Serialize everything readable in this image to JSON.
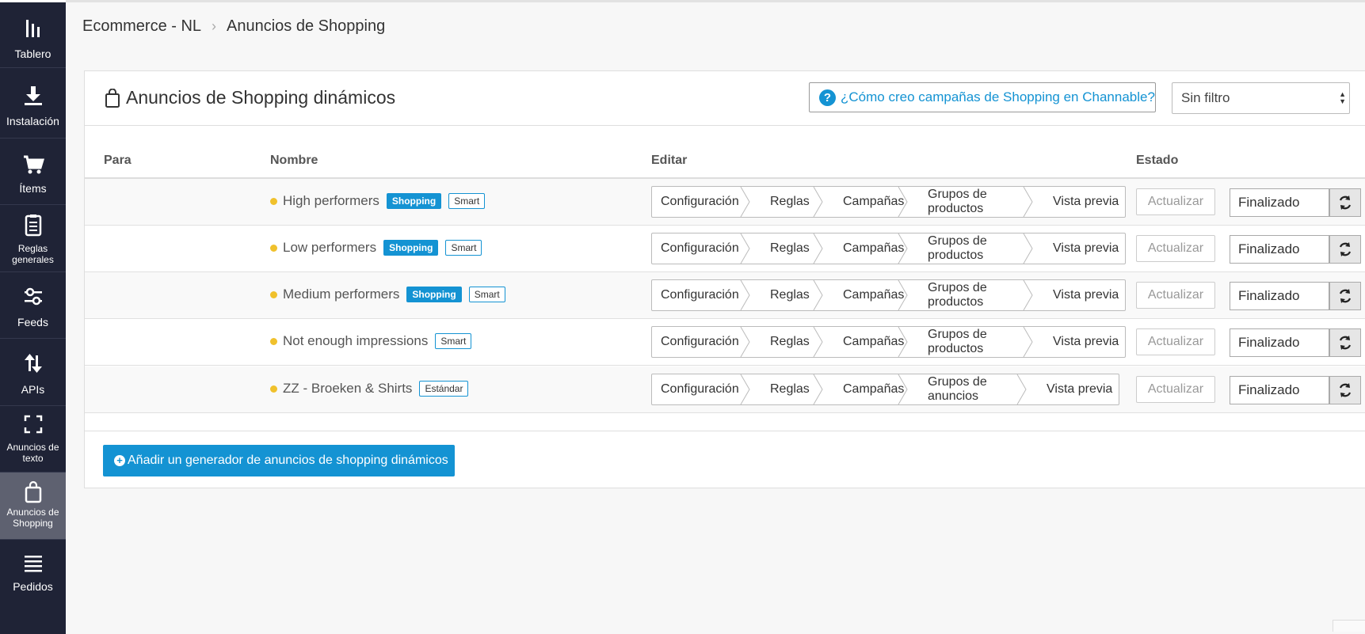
{
  "sidebar": {
    "items": [
      {
        "label": "Tablero",
        "icon": "bar-chart-icon"
      },
      {
        "label": "Instalación",
        "icon": "download-icon"
      },
      {
        "label": "Ítems",
        "icon": "cart-icon"
      },
      {
        "label": "Reglas generales",
        "icon": "clipboard-icon"
      },
      {
        "label": "Feeds",
        "icon": "sliders-icon"
      },
      {
        "label": "APIs",
        "icon": "arrows-updown-icon"
      },
      {
        "label": "Anuncios de texto",
        "icon": "frame-corners-icon"
      },
      {
        "label": "Anuncios de Shopping",
        "icon": "shopping-bag-icon",
        "active": true
      },
      {
        "label": "Pedidos",
        "icon": "list-icon"
      }
    ]
  },
  "breadcrumb": {
    "project": "Ecommerce - NL",
    "current": "Anuncios de Shopping"
  },
  "panel": {
    "title": "Anuncios de Shopping dinámicos",
    "help_link": "¿Cómo creo campañas de Shopping en Channable?",
    "filter": {
      "selected": "Sin filtro"
    },
    "columns": {
      "para": "Para",
      "nombre": "Nombre",
      "editar": "Editar",
      "estado": "Estado"
    },
    "rows": [
      {
        "name": "High performers",
        "tags": [
          "Shopping",
          "Smart"
        ],
        "steps": [
          "Configuración",
          "Reglas",
          "Campañas",
          "Grupos de productos",
          "Vista previa"
        ],
        "update": "Actualizar",
        "status": "Finalizado"
      },
      {
        "name": "Low performers",
        "tags": [
          "Shopping",
          "Smart"
        ],
        "steps": [
          "Configuración",
          "Reglas",
          "Campañas",
          "Grupos de productos",
          "Vista previa"
        ],
        "update": "Actualizar",
        "status": "Finalizado"
      },
      {
        "name": "Medium performers",
        "tags": [
          "Shopping",
          "Smart"
        ],
        "steps": [
          "Configuración",
          "Reglas",
          "Campañas",
          "Grupos de productos",
          "Vista previa"
        ],
        "update": "Actualizar",
        "status": "Finalizado"
      },
      {
        "name": "Not enough impressions",
        "tags": [
          "Smart"
        ],
        "steps": [
          "Configuración",
          "Reglas",
          "Campañas",
          "Grupos de productos",
          "Vista previa"
        ],
        "update": "Actualizar",
        "status": "Finalizado"
      },
      {
        "name": "ZZ - Broeken & Shirts",
        "tags": [
          "Estándar"
        ],
        "steps": [
          "Configuración",
          "Reglas",
          "Campañas",
          "Grupos de anuncios",
          "Vista previa"
        ],
        "update": "Actualizar",
        "status": "Finalizado"
      }
    ],
    "add_button": "Añadir un generador de anuncios de shopping dinámicos"
  },
  "colors": {
    "accent": "#1493d3",
    "sidebar_bg": "#1f2336",
    "status_dot": "#f0c12c"
  }
}
